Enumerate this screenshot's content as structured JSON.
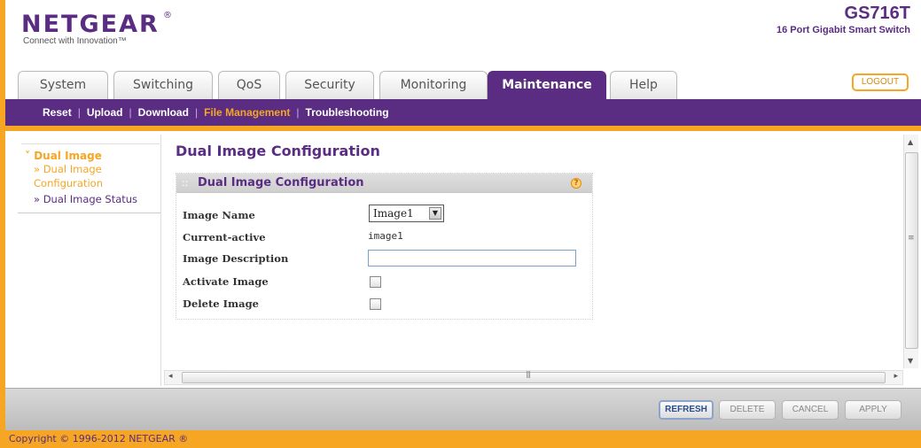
{
  "brand": {
    "logo": "NETGEAR",
    "logo_mark": "®",
    "tagline": "Connect with Innovation™",
    "model": "GS716T",
    "model_desc": "16 Port Gigabit Smart Switch"
  },
  "tabs": [
    {
      "label": "System"
    },
    {
      "label": "Switching"
    },
    {
      "label": "QoS"
    },
    {
      "label": "Security"
    },
    {
      "label": "Monitoring"
    },
    {
      "label": "Maintenance"
    },
    {
      "label": "Help"
    }
  ],
  "logout_label": "LOGOUT",
  "subnav": [
    {
      "label": "Reset"
    },
    {
      "label": "Upload"
    },
    {
      "label": "Download"
    },
    {
      "label": "File Management"
    },
    {
      "label": "Troubleshooting"
    }
  ],
  "leftnav": {
    "group": "Dual Image",
    "items": [
      {
        "label": "» Dual Image Configuration"
      },
      {
        "label": "» Dual Image Status"
      }
    ]
  },
  "page_title": "Dual Image Configuration",
  "box": {
    "title": "Dual Image Configuration",
    "help_icon": "?",
    "fields": {
      "image_name_label": "Image Name",
      "image_name_value": "Image1",
      "current_active_label": "Current-active",
      "current_active_value": "image1",
      "image_desc_label": "Image Description",
      "image_desc_value": "",
      "activate_label": "Activate Image",
      "delete_label": "Delete Image"
    }
  },
  "buttons": {
    "refresh": "REFRESH",
    "delete": "DELETE",
    "cancel": "CANCEL",
    "apply": "APPLY"
  },
  "footer": "Copyright © 1996-2012 NETGEAR ®",
  "colors": {
    "brand_purple": "#5a2d82",
    "accent_orange": "#f6a623"
  }
}
